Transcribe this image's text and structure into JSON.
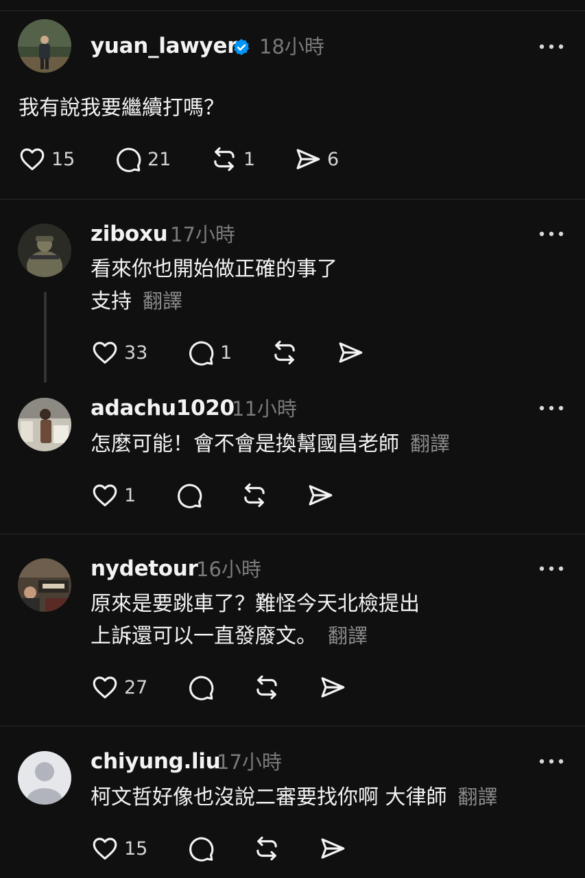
{
  "post": {
    "username": "yuan_lawyer",
    "time": "18小時",
    "text": "我有說我要繼續打嗎？",
    "likes": "15",
    "replies": "21",
    "reposts": "1",
    "shares": "6"
  },
  "comments": [
    {
      "username": "ziboxu",
      "time": "17小時",
      "line1": "看來你也開始做正確的事了",
      "line2": "支持",
      "translate": "翻譯",
      "likes": "33",
      "replies": "1"
    },
    {
      "username": "adachu1020",
      "time": "11小時",
      "line1": "怎麼可能！會不會是換幫國昌老師",
      "translate": "翻譯",
      "likes": "1"
    },
    {
      "username": "nydetour",
      "time": "16小時",
      "line1": "原來是要跳車了？難怪今天北檢提出",
      "line2": "上訴還可以一直發廢文。",
      "translate": "翻譯",
      "likes": "27"
    },
    {
      "username": "chiyung.liu",
      "time": "17小時",
      "line1": "柯文哲好像也沒說二審要找你啊 大律師",
      "translate": "翻譯",
      "likes": "15"
    }
  ],
  "colors": {
    "background": "#101010",
    "verified": "#0095f6",
    "muted": "#7a7a7a"
  }
}
